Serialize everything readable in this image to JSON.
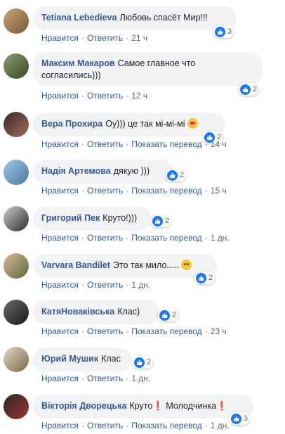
{
  "colors": {
    "link": "#385898",
    "bubble": "#f2f3f5",
    "like": "#1877f2"
  },
  "actions": {
    "like": "Нравится",
    "reply": "Ответить",
    "translate": "Показать перевод",
    "separator": "·"
  },
  "comments": [
    {
      "author": "Tetiana Lebedieva",
      "text": "Любовь спасёт Мир!!!",
      "reactions": "3",
      "time": "21 ч",
      "translate": false
    },
    {
      "author": "Максим Макаров",
      "text": "Самое главное что согласились)))",
      "reactions": "2",
      "time": "12 ч",
      "translate": false
    },
    {
      "author": "Вера Прохира",
      "text": "Оу))) це так мі-мі-мі",
      "emoji": "heart-eyes-emoji",
      "reactions": "2",
      "time": "14 ч",
      "translate": true
    },
    {
      "author": "Надія Артемова",
      "text": "дякую )))",
      "reactions": "2",
      "time": "15 ч",
      "translate": true
    },
    {
      "author": "Григорий Пек",
      "text": "Круто!)))",
      "reactions": "2",
      "time": "1 дн.",
      "translate": true
    },
    {
      "author": "Varvara Bandilet",
      "text": "Это так мило.....",
      "emoji": "hugging-emoji",
      "reactions": "2",
      "time": "1 дн.",
      "translate": false
    },
    {
      "author": "КатяНоваківська",
      "text": "Клас)",
      "reactions": "2",
      "time": "23 ч",
      "translate": true
    },
    {
      "author": "Юрий Мушик",
      "text": "Клас",
      "reactions": "2",
      "time": "1 дн.",
      "translate": false
    },
    {
      "author": "Вікторія Дворецька",
      "text": "Круто❗ Молодчинка❗",
      "reactions": "3",
      "time": "1 дн.",
      "translate": true
    }
  ]
}
